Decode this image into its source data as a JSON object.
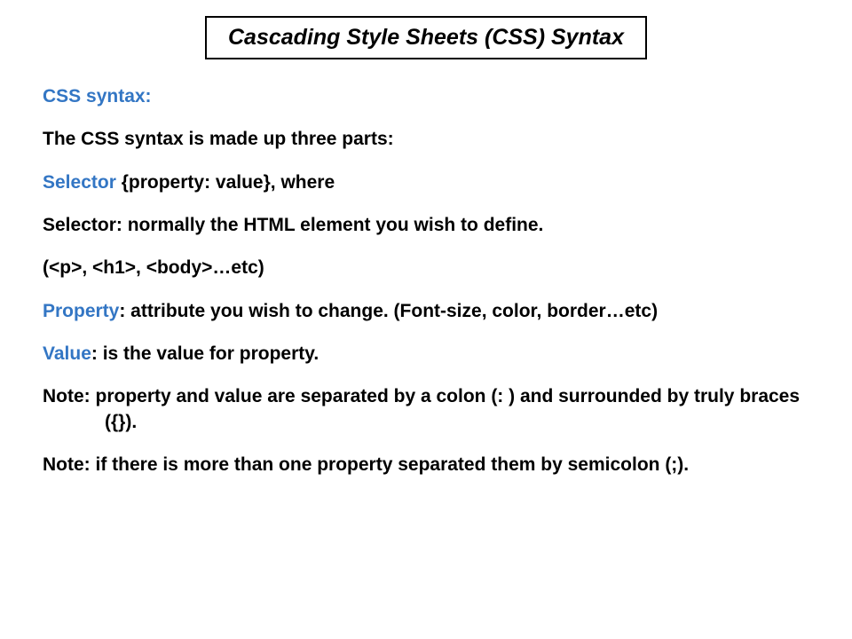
{
  "title": "Cascading Style Sheets (CSS) Syntax",
  "lines": {
    "l1": "CSS syntax:",
    "l2": "The CSS syntax is made up three parts:",
    "l3a": "Selector ",
    "l3b": "{property: value}, where",
    "l4": "Selector: normally the HTML element you wish to define.",
    "l5": "(<p>, <h1>, <body>…etc)",
    "l6a": "Property",
    "l6b": ": attribute you wish to change. (Font-size, color, border…etc)",
    "l7a": "Value",
    "l7b": ": is the value for property.",
    "l8": "Note: property and value are separated by a colon (: ) and surrounded by truly braces ({}).",
    "l9": "Note: if there is more than one property separated them by semicolon (;)."
  }
}
